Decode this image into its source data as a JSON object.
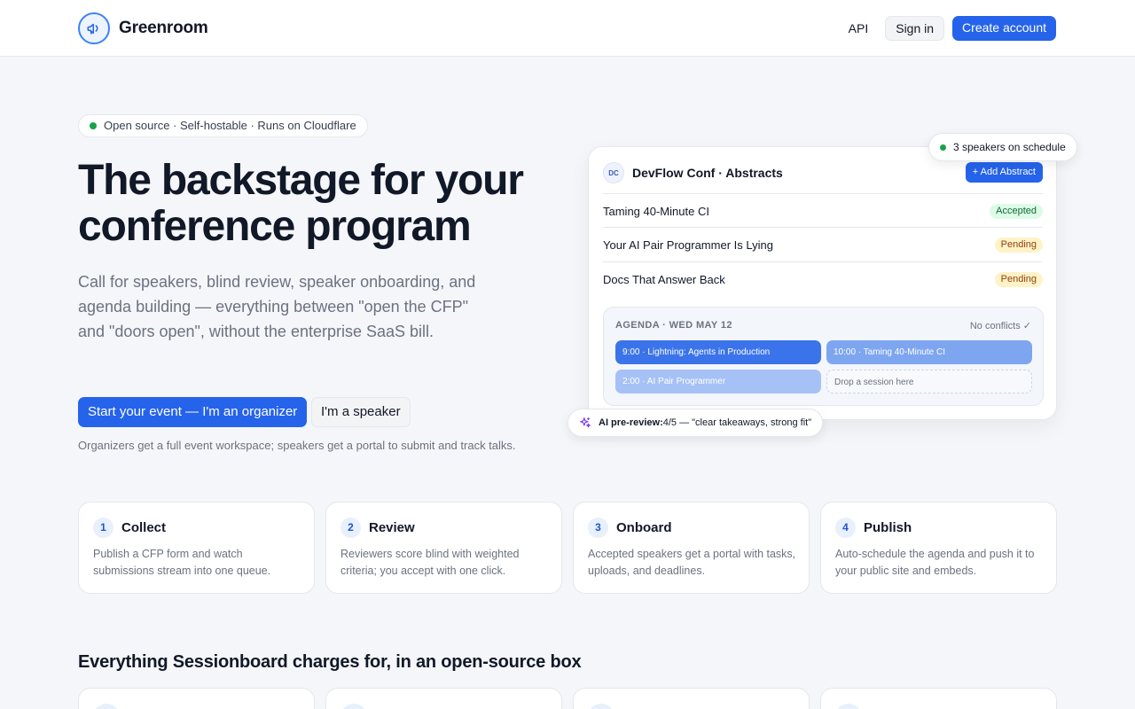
{
  "header": {
    "brand": "Greenroom",
    "nav": {
      "api": "API",
      "sign_in": "Sign in",
      "create_account": "Create account"
    }
  },
  "hero": {
    "pill": "Open source · Self-hostable · Runs on Cloudflare",
    "title": "The backstage for your conference program",
    "subtitle": "Call for speakers, blind review, speaker onboarding, and agenda building — everything between \"open the CFP\" and \"doors open\", without the enterprise SaaS bill.",
    "primary_cta": "Start your event — I'm an organizer",
    "secondary_cta": "I'm a speaker",
    "note": "Organizers get a full event workspace; speakers get a portal to submit and track talks."
  },
  "preview": {
    "badge": "DC",
    "title": "DevFlow Conf · Abstracts",
    "add_button": "+ Add Abstract",
    "abstracts": [
      {
        "title": "Taming 40-Minute CI",
        "status": "Accepted"
      },
      {
        "title": "Your AI Pair Programmer Is Lying",
        "status": "Pending"
      },
      {
        "title": "Docs That Answer Back",
        "status": "Pending"
      }
    ],
    "agenda": {
      "label": "AGENDA · WED MAY 12",
      "status": "No conflicts ✓",
      "slots": [
        "9:00 · Lightning: Agents in Production",
        "10:00 · Taming 40-Minute CI",
        "2:00 · AI Pair Programmer"
      ],
      "drop_hint": "Drop a session here"
    },
    "speakers_badge": "3 speakers on schedule",
    "ai_label": "AI pre-review:",
    "ai_text": "4/5 — \"clear takeaways, strong fit\""
  },
  "steps": [
    {
      "num": "1",
      "title": "Collect",
      "desc": "Publish a CFP form and watch submissions stream into one queue."
    },
    {
      "num": "2",
      "title": "Review",
      "desc": "Reviewers score blind with weighted criteria; you accept with one click."
    },
    {
      "num": "3",
      "title": "Onboard",
      "desc": "Accepted speakers get a portal with tasks, uploads, and deadlines."
    },
    {
      "num": "4",
      "title": "Publish",
      "desc": "Auto-schedule the agenda and push it to your public site and embeds."
    }
  ],
  "features": {
    "title": "Everything Sessionboard charges for, in an open-source box"
  },
  "colors": {
    "accent": "#2563eb",
    "success": "#16a34a",
    "pending": "#fef3c7",
    "accepted": "#dcfce7"
  }
}
